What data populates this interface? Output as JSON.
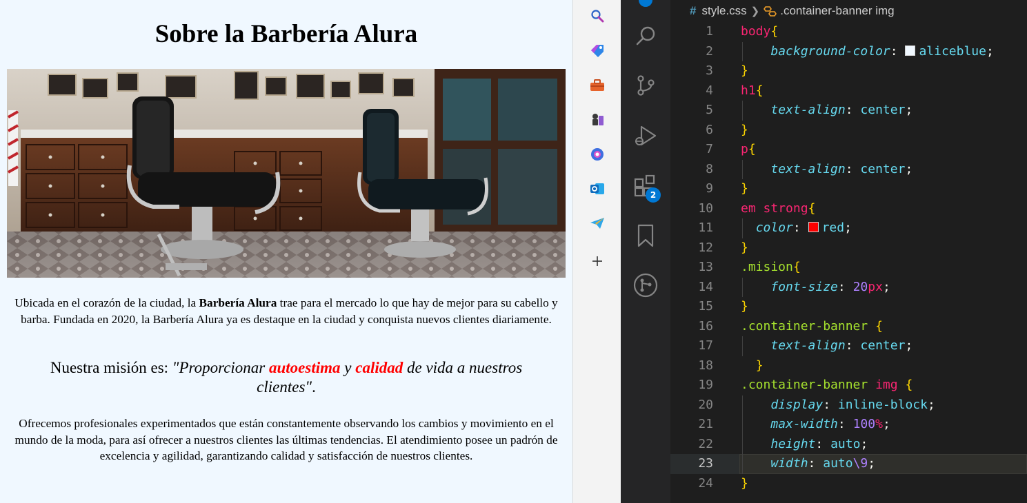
{
  "preview": {
    "title": "Sobre la Barbería Alura",
    "p1_before": "Ubicada en el corazón de la ciudad, la ",
    "p1_strong": "Barbería Alura",
    "p1_after": " trae para el mercado lo que hay de mejor para su cabello y barba. Fundada en 2020, la Barbería Alura ya es destaque en la ciudad y conquista nuevos clientes diariamente.",
    "mision_prefix": "Nuestra misión es: ",
    "mision_em1": "\"Proporcionar ",
    "mision_strong1": "autoestima",
    "mision_em2": " y ",
    "mision_strong2": "calidad",
    "mision_em3": " de vida a nuestros clientes\"",
    "mision_suffix": ".",
    "p3": "Ofrecemos profesionales experimentados que están constantemente observando los cambios y movimiento en el mundo de la moda, para así ofrecer a nuestros clientes las últimas tendencias. El atendimiento posee un padrón de excelencia y agilidad, garantizando calidad y satisfacción de nuestros clientes."
  },
  "edge_sidebar": {
    "icons": [
      "search-icon",
      "tag-icon",
      "toolbox-icon",
      "chess-icon",
      "copilot-icon",
      "outlook-icon",
      "telegram-icon",
      "plus-icon"
    ]
  },
  "vscode": {
    "extensions_badge": "2",
    "breadcrumb": {
      "file": "style.css",
      "symbol": ".container-banner img"
    },
    "lines": [
      {
        "n": "1",
        "code": "body{"
      },
      {
        "n": "2",
        "code": "    background-color: aliceblue;"
      },
      {
        "n": "3",
        "code": "}"
      },
      {
        "n": "4",
        "code": "h1{"
      },
      {
        "n": "5",
        "code": "    text-align: center;"
      },
      {
        "n": "6",
        "code": "}"
      },
      {
        "n": "7",
        "code": "p{"
      },
      {
        "n": "8",
        "code": "    text-align: center;"
      },
      {
        "n": "9",
        "code": "}"
      },
      {
        "n": "10",
        "code": "em strong{"
      },
      {
        "n": "11",
        "code": "  color: red;"
      },
      {
        "n": "12",
        "code": "}"
      },
      {
        "n": "13",
        "code": ".mision{"
      },
      {
        "n": "14",
        "code": "    font-size: 20px;"
      },
      {
        "n": "15",
        "code": "}"
      },
      {
        "n": "16",
        "code": ".container-banner {"
      },
      {
        "n": "17",
        "code": "    text-align: center;"
      },
      {
        "n": "18",
        "code": "  }"
      },
      {
        "n": "19",
        "code": ".container-banner img {"
      },
      {
        "n": "20",
        "code": "    display: inline-block;"
      },
      {
        "n": "21",
        "code": "    max-width: 100%;"
      },
      {
        "n": "22",
        "code": "    height: auto;"
      },
      {
        "n": "23",
        "code": "    width: auto\\9;"
      },
      {
        "n": "24",
        "code": "}"
      }
    ],
    "active_line": "23",
    "colors": {
      "aliceblue_swatch": "#f0f8ff",
      "red_swatch": "#ff0000"
    }
  }
}
